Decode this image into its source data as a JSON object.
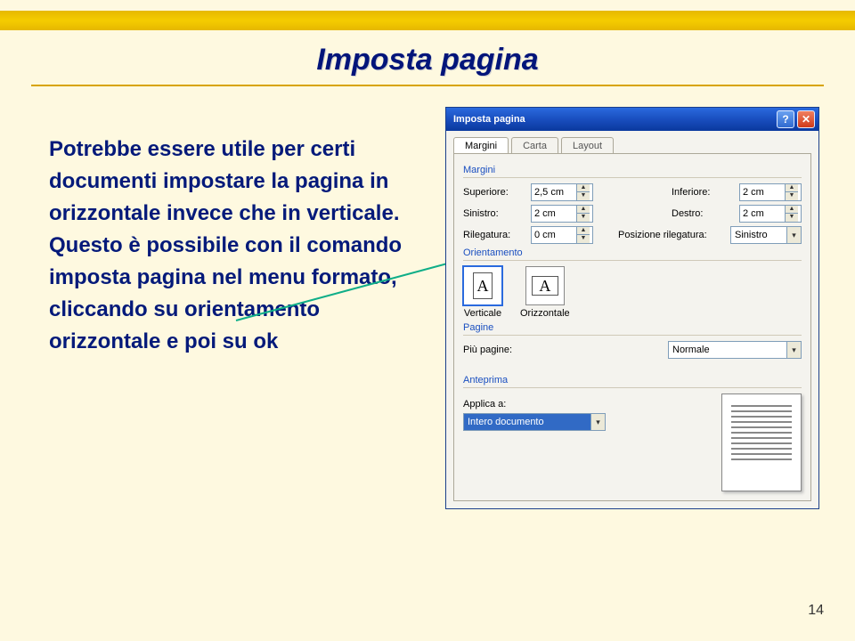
{
  "slide": {
    "title": "Imposta pagina",
    "body": "Potrebbe essere utile per certi documenti impostare la pagina in orizzontale invece che in verticale. Questo è possibile con il comando imposta pagina nel menu formato, cliccando su orientamento orizzontale e poi su ok",
    "page_number": "14"
  },
  "dialog": {
    "title": "Imposta pagina",
    "tabs": [
      "Margini",
      "Carta",
      "Layout"
    ],
    "margins": {
      "section_label": "Margini",
      "superiore_label": "Superiore:",
      "superiore": "2,5 cm",
      "inferiore_label": "Inferiore:",
      "inferiore": "2 cm",
      "sinistro_label": "Sinistro:",
      "sinistro": "2 cm",
      "destro_label": "Destro:",
      "destro": "2 cm",
      "rilegatura_label": "Rilegatura:",
      "rilegatura": "0 cm",
      "pos_rilegatura_label": "Posizione rilegatura:",
      "pos_rilegatura": "Sinistro"
    },
    "orientation": {
      "section_label": "Orientamento",
      "vertical": "Verticale",
      "horizontal": "Orizzontale",
      "glyph": "A"
    },
    "pages": {
      "section_label": "Pagine",
      "piu_pagine_label": "Più pagine:",
      "piu_pagine": "Normale"
    },
    "preview": {
      "section_label": "Anteprima",
      "applica_label": "Applica a:",
      "applica": "Intero documento"
    }
  }
}
